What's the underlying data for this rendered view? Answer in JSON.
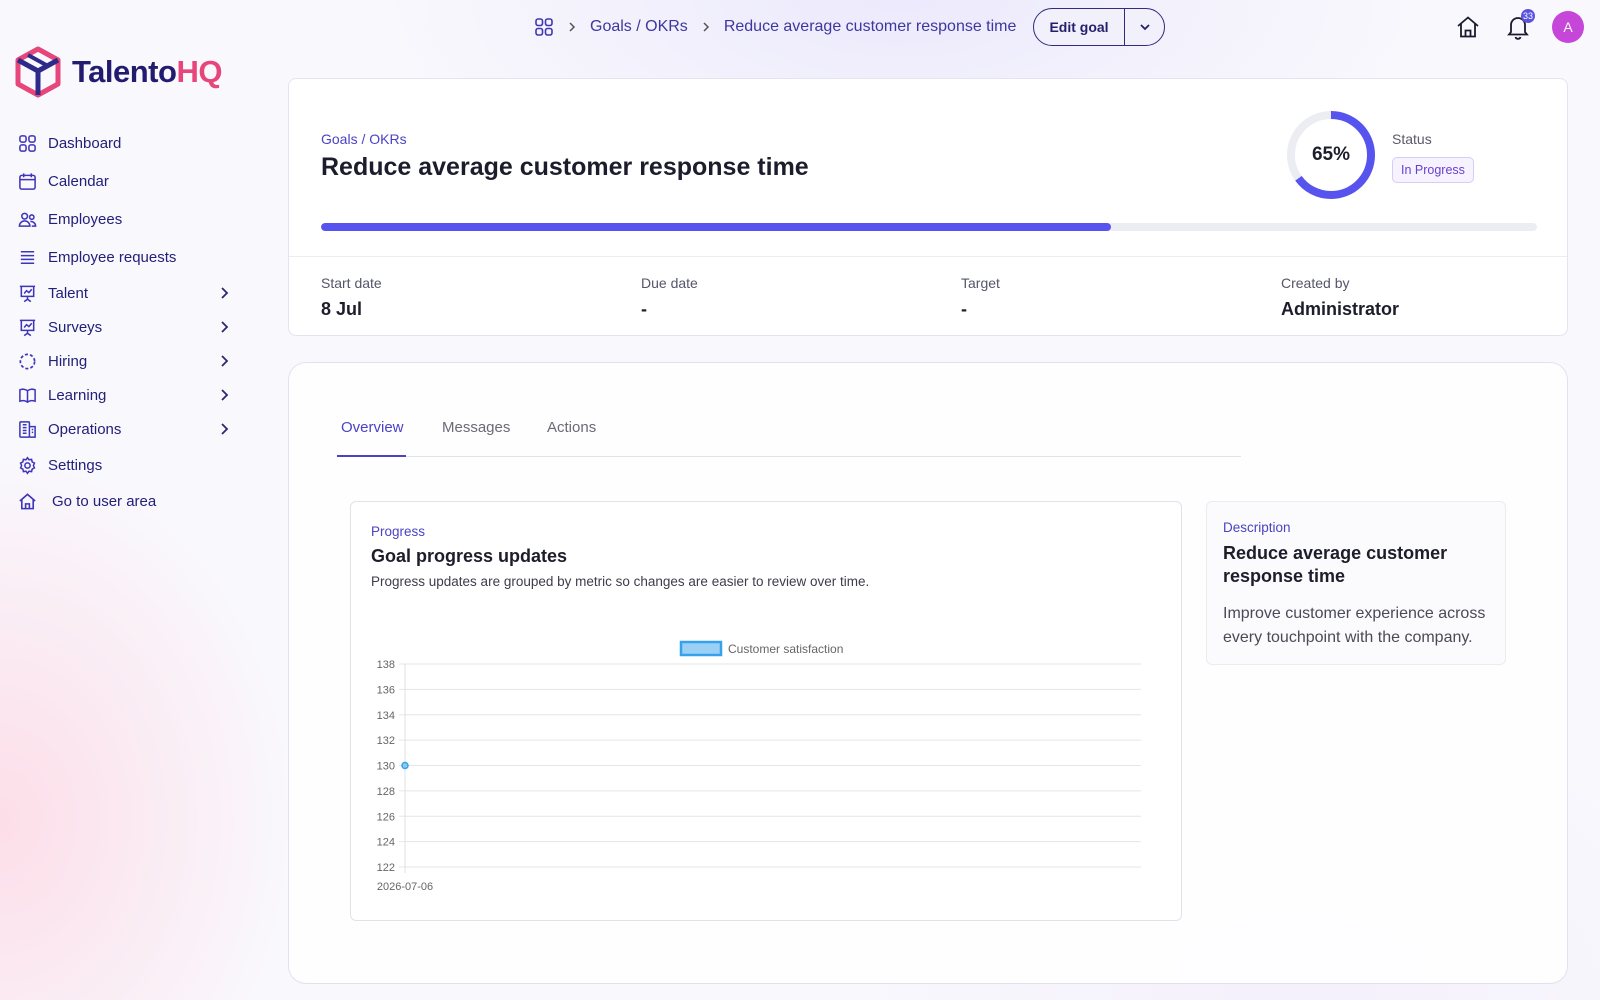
{
  "brand": {
    "name_part1": "Talento",
    "name_part2": "HQ",
    "accent": "#3e36b8",
    "accent_pink": "#e6467a"
  },
  "sidebar": {
    "items": [
      {
        "label": "Dashboard",
        "icon": "grid-icon"
      },
      {
        "label": "Calendar",
        "icon": "calendar-icon"
      },
      {
        "label": "Employees",
        "icon": "users-icon"
      },
      {
        "label": "Employee requests",
        "icon": "list-icon"
      },
      {
        "label": "Talent",
        "icon": "presentation-icon"
      },
      {
        "label": "Surveys",
        "icon": "presentation-icon"
      },
      {
        "label": "Hiring",
        "icon": "dashed-circle-icon"
      },
      {
        "label": "Learning",
        "icon": "book-icon"
      },
      {
        "label": "Operations",
        "icon": "building-icon"
      },
      {
        "label": "Settings",
        "icon": "gear-icon"
      },
      {
        "label": "Go to user area",
        "icon": "home-icon"
      }
    ]
  },
  "topbar": {
    "breadcrumbs": [
      "Goals / OKRs",
      "Reduce average customer response time"
    ],
    "edit_label": "Edit goal",
    "notification_count": "33",
    "avatar_initial": "A"
  },
  "goal": {
    "kicker": "Goals / OKRs",
    "title": "Reduce average customer response time",
    "progress_percent": 65,
    "progress_label": "65%",
    "status_label": "Status",
    "status_value": "In Progress",
    "meta": [
      {
        "label": "Start date",
        "value": "8 Jul"
      },
      {
        "label": "Due date",
        "value": "-"
      },
      {
        "label": "Target",
        "value": "-"
      },
      {
        "label": "Created by",
        "value": "Administrator"
      }
    ]
  },
  "tabs": [
    "Overview",
    "Messages",
    "Actions"
  ],
  "progress_card": {
    "kicker": "Progress",
    "title": "Goal progress updates",
    "description": "Progress updates are grouped by metric so changes are easier to review over time."
  },
  "description_card": {
    "kicker": "Description",
    "title": "Reduce average customer response time",
    "body": "Improve customer experience across every touchpoint with the company."
  },
  "chart_data": {
    "type": "line",
    "x": [
      "2026-07-06"
    ],
    "series": [
      {
        "name": "Customer satisfaction",
        "values": [
          130
        ],
        "color": "#36a2eb"
      }
    ],
    "ylim": [
      122,
      138
    ],
    "yticks": [
      138,
      136,
      134,
      132,
      130,
      128,
      126,
      124,
      122
    ],
    "legend": "top-center",
    "grid": true
  }
}
